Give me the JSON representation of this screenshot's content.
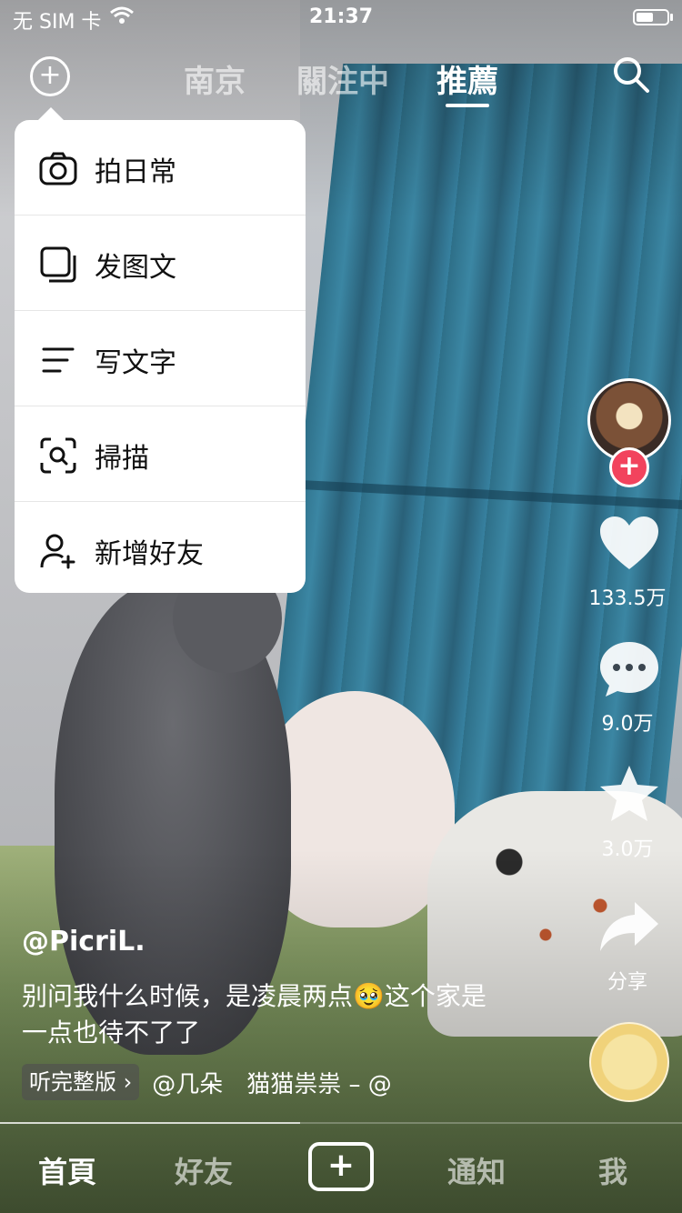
{
  "status_bar": {
    "carrier": "无 SIM 卡",
    "time": "21:37"
  },
  "top_nav": {
    "tabs": [
      {
        "label": "南京"
      },
      {
        "label": "關注中"
      },
      {
        "label": "推薦",
        "active": true
      }
    ]
  },
  "menu": {
    "items": [
      {
        "label": "拍日常",
        "icon": "camera-icon"
      },
      {
        "label": "发图文",
        "icon": "gallery-icon"
      },
      {
        "label": "写文字",
        "icon": "text-lines-icon"
      },
      {
        "label": "掃描",
        "icon": "scan-icon"
      },
      {
        "label": "新增好友",
        "icon": "add-friend-icon"
      }
    ]
  },
  "rail": {
    "likes": "133.5万",
    "comments": "9.0万",
    "favorites": "3.0万",
    "share": "分享",
    "follow": "+"
  },
  "video": {
    "username": "@PicriL.",
    "description": "别问我什么时候，是凌晨两点🥹这个家是一点也待不了了",
    "music_badge": "听完整版 ›",
    "music_text": "@几朵　猫猫祟祟 – @",
    "progress": 0.44
  },
  "bottom_nav": {
    "items": [
      {
        "label": "首頁",
        "active": true
      },
      {
        "label": "好友"
      },
      {
        "label": "+"
      },
      {
        "label": "通知"
      },
      {
        "label": "我"
      }
    ]
  },
  "colors": {
    "follow": "#f2435d",
    "menu_bg": "#ffffff"
  }
}
